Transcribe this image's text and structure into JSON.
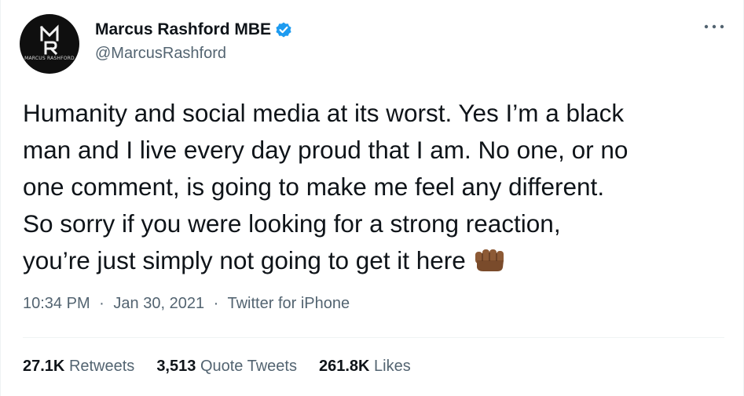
{
  "user": {
    "display_name": "Marcus Rashford MBE",
    "handle": "@MarcusRashford",
    "verified": true,
    "avatar_monogram": "MR",
    "avatar_caption": "MARCUS RASHFORD",
    "verified_color": "#1d9bf0"
  },
  "tweet": {
    "lines": [
      "Humanity and social media at its worst. Yes I’m a black",
      "man and I live every day proud that I am. No one, or no",
      "one comment, is going to make me feel any different.",
      "So sorry if you were looking for a strong reaction,",
      "you’re just simply not going to get it here"
    ],
    "emoji": "raised-fist-medium-dark-skin-icon"
  },
  "meta": {
    "time": "10:34 PM",
    "separator": "·",
    "date": "Jan 30, 2021",
    "source": "Twitter for iPhone"
  },
  "stats": {
    "retweets_count": "27.1K",
    "retweets_label": "Retweets",
    "quote_count": "3,513",
    "quote_label": "Quote Tweets",
    "likes_count": "261.8K",
    "likes_label": "Likes"
  },
  "colors": {
    "text_primary": "#0f1419",
    "text_secondary": "#536471",
    "divider": "#eff3f4",
    "emoji_skin": "#8d5a35"
  }
}
